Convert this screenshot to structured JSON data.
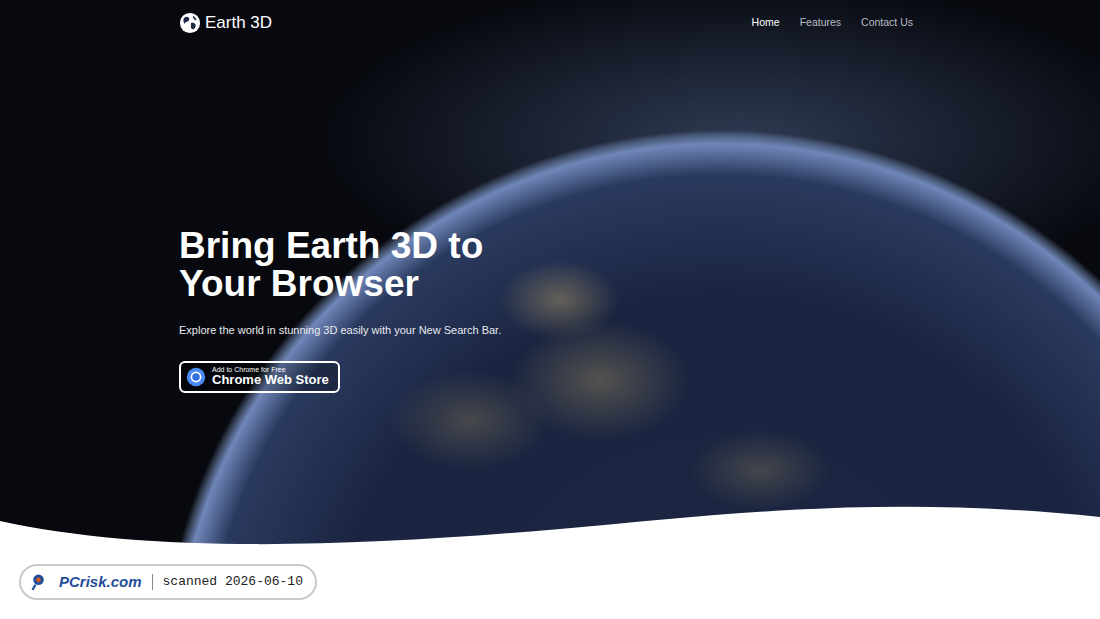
{
  "brand": {
    "name": "Earth 3D"
  },
  "nav": [
    {
      "label": "Home",
      "selected": true
    },
    {
      "label": "Features",
      "selected": false
    },
    {
      "label": "Contact Us",
      "selected": false
    }
  ],
  "hero": {
    "title": "Bring Earth 3D to Your Browser",
    "subtitle": "Explore the world in stunning 3D easily with your New Search Bar.",
    "cta": {
      "small": "Add to Chrome for Free",
      "large": "Chrome Web Store"
    }
  },
  "watermark": {
    "site": "PCrisk.com",
    "text": "scanned 2026-06-10"
  }
}
